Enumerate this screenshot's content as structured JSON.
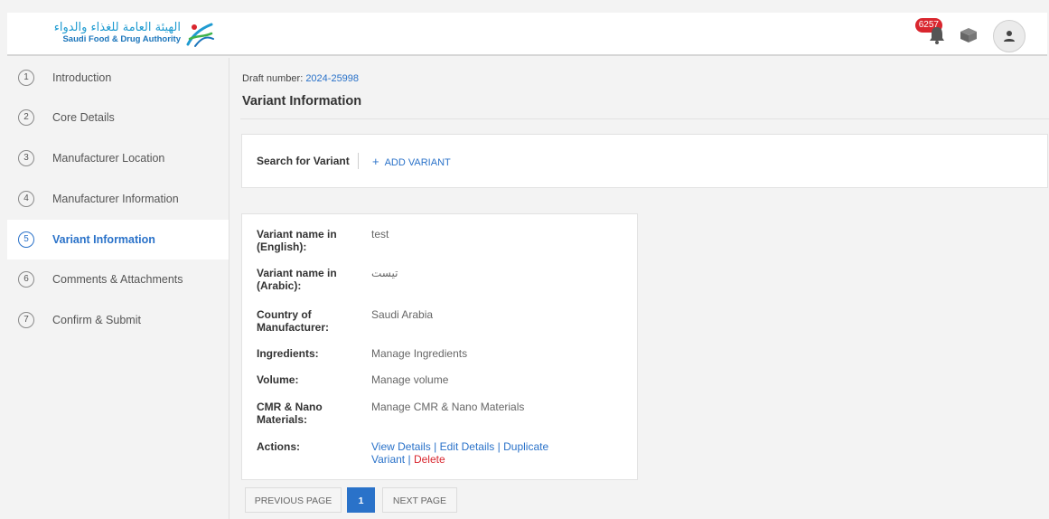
{
  "header": {
    "logo_ar": "الهيئة العامة للغذاء والدواء",
    "logo_en": "Saudi Food & Drug Authority",
    "notification_count": "6257",
    "icons": [
      "bell-icon",
      "box-icon",
      "user-icon"
    ]
  },
  "sidebar": {
    "steps": [
      {
        "num": "1",
        "label": "Introduction"
      },
      {
        "num": "2",
        "label": "Core Details"
      },
      {
        "num": "3",
        "label": "Manufacturer Location"
      },
      {
        "num": "4",
        "label": "Manufacturer Information"
      },
      {
        "num": "5",
        "label": "Variant Information",
        "active": true
      },
      {
        "num": "6",
        "label": "Comments & Attachments"
      },
      {
        "num": "7",
        "label": "Confirm & Submit"
      }
    ]
  },
  "main": {
    "draft_label": "Draft number:",
    "draft_number": "2024-25998",
    "title": "Variant Information",
    "search_label": "Search for Variant",
    "add_variant": "ADD VARIANT"
  },
  "variant": {
    "name_en_label": "Variant name in (English):",
    "name_en": "test",
    "name_ar_label": "Variant name in (Arabic):",
    "name_ar": "تيست",
    "country_label": "Country of Manufacturer:",
    "country": "Saudi Arabia",
    "ingredients_label": "Ingredients:",
    "ingredients_link": "Manage Ingredients",
    "volume_label": "Volume:",
    "volume_link": "Manage volume",
    "cmr_label": "CMR & Nano Materials:",
    "cmr_link": "Manage CMR & Nano Materials",
    "actions_label": "Actions:",
    "view_details": "View Details",
    "edit_details": "Edit Details",
    "duplicate": "Duplicate Variant",
    "delete": "Delete",
    "separator": " | "
  },
  "pagination": {
    "prev": "PREVIOUS PAGE",
    "current": "1",
    "next": "NEXT PAGE"
  },
  "colors": {
    "accent": "#2a72c9",
    "danger": "#d9262e",
    "badge": "#d9262e"
  }
}
